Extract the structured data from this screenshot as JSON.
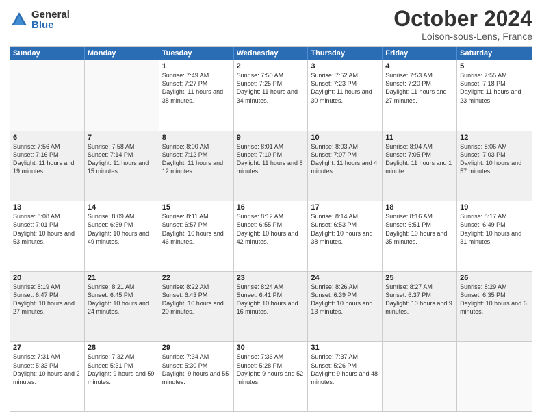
{
  "logo": {
    "general": "General",
    "blue": "Blue"
  },
  "header": {
    "month": "October 2024",
    "location": "Loison-sous-Lens, France"
  },
  "weekdays": [
    "Sunday",
    "Monday",
    "Tuesday",
    "Wednesday",
    "Thursday",
    "Friday",
    "Saturday"
  ],
  "rows": [
    [
      {
        "day": "",
        "empty": true
      },
      {
        "day": "",
        "empty": true
      },
      {
        "day": "1",
        "sunrise": "Sunrise: 7:49 AM",
        "sunset": "Sunset: 7:27 PM",
        "daylight": "Daylight: 11 hours and 38 minutes."
      },
      {
        "day": "2",
        "sunrise": "Sunrise: 7:50 AM",
        "sunset": "Sunset: 7:25 PM",
        "daylight": "Daylight: 11 hours and 34 minutes."
      },
      {
        "day": "3",
        "sunrise": "Sunrise: 7:52 AM",
        "sunset": "Sunset: 7:23 PM",
        "daylight": "Daylight: 11 hours and 30 minutes."
      },
      {
        "day": "4",
        "sunrise": "Sunrise: 7:53 AM",
        "sunset": "Sunset: 7:20 PM",
        "daylight": "Daylight: 11 hours and 27 minutes."
      },
      {
        "day": "5",
        "sunrise": "Sunrise: 7:55 AM",
        "sunset": "Sunset: 7:18 PM",
        "daylight": "Daylight: 11 hours and 23 minutes."
      }
    ],
    [
      {
        "day": "6",
        "sunrise": "Sunrise: 7:56 AM",
        "sunset": "Sunset: 7:16 PM",
        "daylight": "Daylight: 11 hours and 19 minutes."
      },
      {
        "day": "7",
        "sunrise": "Sunrise: 7:58 AM",
        "sunset": "Sunset: 7:14 PM",
        "daylight": "Daylight: 11 hours and 15 minutes."
      },
      {
        "day": "8",
        "sunrise": "Sunrise: 8:00 AM",
        "sunset": "Sunset: 7:12 PM",
        "daylight": "Daylight: 11 hours and 12 minutes."
      },
      {
        "day": "9",
        "sunrise": "Sunrise: 8:01 AM",
        "sunset": "Sunset: 7:10 PM",
        "daylight": "Daylight: 11 hours and 8 minutes."
      },
      {
        "day": "10",
        "sunrise": "Sunrise: 8:03 AM",
        "sunset": "Sunset: 7:07 PM",
        "daylight": "Daylight: 11 hours and 4 minutes."
      },
      {
        "day": "11",
        "sunrise": "Sunrise: 8:04 AM",
        "sunset": "Sunset: 7:05 PM",
        "daylight": "Daylight: 11 hours and 1 minute."
      },
      {
        "day": "12",
        "sunrise": "Sunrise: 8:06 AM",
        "sunset": "Sunset: 7:03 PM",
        "daylight": "Daylight: 10 hours and 57 minutes."
      }
    ],
    [
      {
        "day": "13",
        "sunrise": "Sunrise: 8:08 AM",
        "sunset": "Sunset: 7:01 PM",
        "daylight": "Daylight: 10 hours and 53 minutes."
      },
      {
        "day": "14",
        "sunrise": "Sunrise: 8:09 AM",
        "sunset": "Sunset: 6:59 PM",
        "daylight": "Daylight: 10 hours and 49 minutes."
      },
      {
        "day": "15",
        "sunrise": "Sunrise: 8:11 AM",
        "sunset": "Sunset: 6:57 PM",
        "daylight": "Daylight: 10 hours and 46 minutes."
      },
      {
        "day": "16",
        "sunrise": "Sunrise: 8:12 AM",
        "sunset": "Sunset: 6:55 PM",
        "daylight": "Daylight: 10 hours and 42 minutes."
      },
      {
        "day": "17",
        "sunrise": "Sunrise: 8:14 AM",
        "sunset": "Sunset: 6:53 PM",
        "daylight": "Daylight: 10 hours and 38 minutes."
      },
      {
        "day": "18",
        "sunrise": "Sunrise: 8:16 AM",
        "sunset": "Sunset: 6:51 PM",
        "daylight": "Daylight: 10 hours and 35 minutes."
      },
      {
        "day": "19",
        "sunrise": "Sunrise: 8:17 AM",
        "sunset": "Sunset: 6:49 PM",
        "daylight": "Daylight: 10 hours and 31 minutes."
      }
    ],
    [
      {
        "day": "20",
        "sunrise": "Sunrise: 8:19 AM",
        "sunset": "Sunset: 6:47 PM",
        "daylight": "Daylight: 10 hours and 27 minutes."
      },
      {
        "day": "21",
        "sunrise": "Sunrise: 8:21 AM",
        "sunset": "Sunset: 6:45 PM",
        "daylight": "Daylight: 10 hours and 24 minutes."
      },
      {
        "day": "22",
        "sunrise": "Sunrise: 8:22 AM",
        "sunset": "Sunset: 6:43 PM",
        "daylight": "Daylight: 10 hours and 20 minutes."
      },
      {
        "day": "23",
        "sunrise": "Sunrise: 8:24 AM",
        "sunset": "Sunset: 6:41 PM",
        "daylight": "Daylight: 10 hours and 16 minutes."
      },
      {
        "day": "24",
        "sunrise": "Sunrise: 8:26 AM",
        "sunset": "Sunset: 6:39 PM",
        "daylight": "Daylight: 10 hours and 13 minutes."
      },
      {
        "day": "25",
        "sunrise": "Sunrise: 8:27 AM",
        "sunset": "Sunset: 6:37 PM",
        "daylight": "Daylight: 10 hours and 9 minutes."
      },
      {
        "day": "26",
        "sunrise": "Sunrise: 8:29 AM",
        "sunset": "Sunset: 6:35 PM",
        "daylight": "Daylight: 10 hours and 6 minutes."
      }
    ],
    [
      {
        "day": "27",
        "sunrise": "Sunrise: 7:31 AM",
        "sunset": "Sunset: 5:33 PM",
        "daylight": "Daylight: 10 hours and 2 minutes."
      },
      {
        "day": "28",
        "sunrise": "Sunrise: 7:32 AM",
        "sunset": "Sunset: 5:31 PM",
        "daylight": "Daylight: 9 hours and 59 minutes."
      },
      {
        "day": "29",
        "sunrise": "Sunrise: 7:34 AM",
        "sunset": "Sunset: 5:30 PM",
        "daylight": "Daylight: 9 hours and 55 minutes."
      },
      {
        "day": "30",
        "sunrise": "Sunrise: 7:36 AM",
        "sunset": "Sunset: 5:28 PM",
        "daylight": "Daylight: 9 hours and 52 minutes."
      },
      {
        "day": "31",
        "sunrise": "Sunrise: 7:37 AM",
        "sunset": "Sunset: 5:26 PM",
        "daylight": "Daylight: 9 hours and 48 minutes."
      },
      {
        "day": "",
        "empty": true
      },
      {
        "day": "",
        "empty": true
      }
    ]
  ]
}
